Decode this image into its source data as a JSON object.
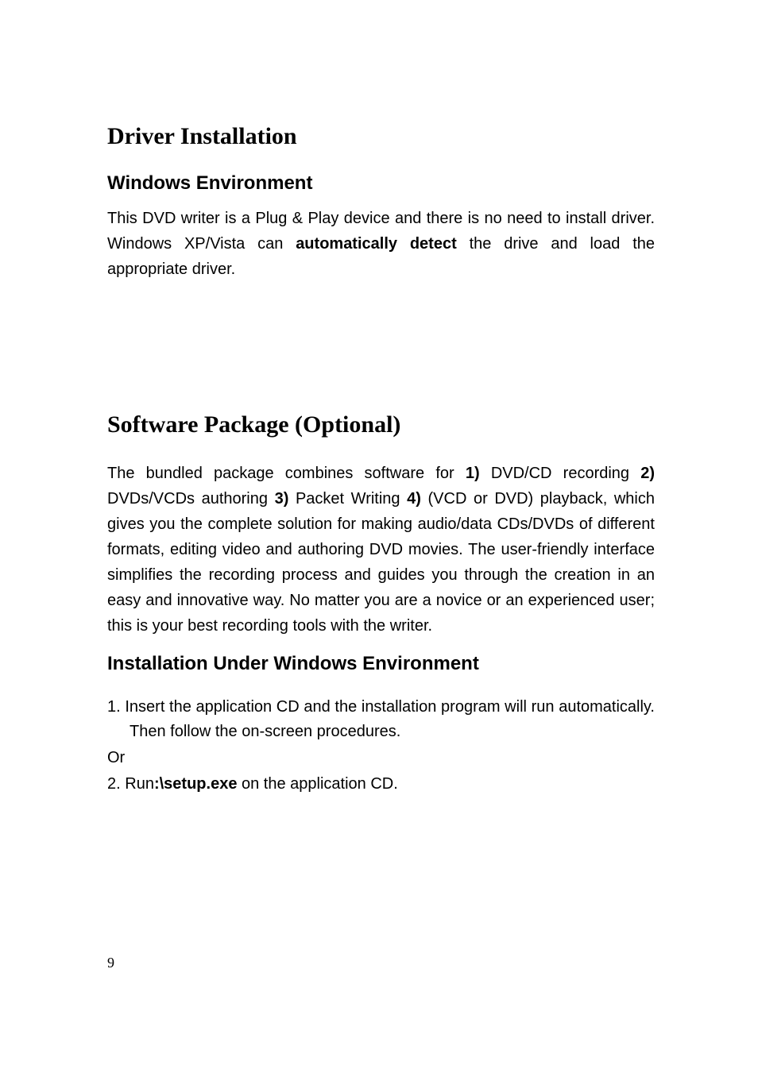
{
  "section1": {
    "heading": "Driver Installation",
    "subheading": "Windows Environment",
    "p1_a": "This DVD writer is a Plug & Play device and there is no need to install driver. Windows XP/Vista can ",
    "p1_b": "automatically detect",
    "p1_c": " the drive and load the appropriate driver."
  },
  "section2": {
    "heading": "Software Package (Optional)",
    "p1_a": "The bundled package combines software for ",
    "p1_b": "1)",
    "p1_c": " DVD/CD recording ",
    "p1_d": "2)",
    "p1_e": " DVDs/VCDs authoring ",
    "p1_f": "3)",
    "p1_g": " Packet Writing ",
    "p1_h": "4)",
    "p1_i": " (VCD or DVD) playback, which gives you the complete solution for making audio/data CDs/DVDs of different formats, editing video and authoring DVD movies. The user-friendly interface simplifies the recording process and guides you through the creation in an easy and innovative way. No matter you are a novice or an experienced user; this is your best recording tools with the writer.",
    "subheading": "Installation Under Windows Environment",
    "list": {
      "num1": "1. ",
      "item1": "Insert the application CD and the installation program will run automatically. Then follow the on-screen procedures.",
      "or": "Or",
      "num2": "2.  ",
      "item2a": "Run",
      "item2b": ":\\setup.exe",
      "item2c": " on the application CD."
    }
  },
  "page_number": "9"
}
